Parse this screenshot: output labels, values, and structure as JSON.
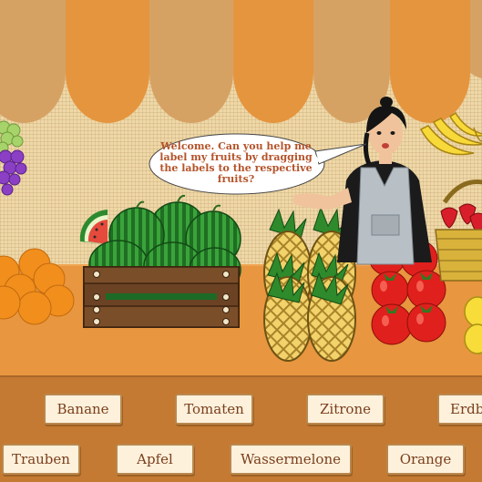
{
  "game": {
    "speech": "Welcome.  Can you help me label my fruits by dragging the labels to the respective fruits?"
  },
  "labels": [
    "Banane",
    "Tomaten",
    "Zitrone",
    "Erdbe",
    "Trauben",
    "Apfel",
    "Wassermelone",
    "Orange"
  ],
  "colors": {
    "awning_dark": "#e5953e",
    "awning_light": "#d6a264",
    "counter": "#e8963f",
    "tray": "#c47a32",
    "label_bg": "#fdf1dc",
    "label_text": "#7a3e1c",
    "bubble_text": "#b5532a"
  },
  "icons": [
    "grapes-icon",
    "orange-icon",
    "watermelon-icon",
    "wooden-crate-icon",
    "pineapple-icon",
    "tomato-icon",
    "banana-icon",
    "strawberry-basket-icon",
    "lemon-icon",
    "shopkeeper-icon",
    "speech-bubble-icon"
  ]
}
